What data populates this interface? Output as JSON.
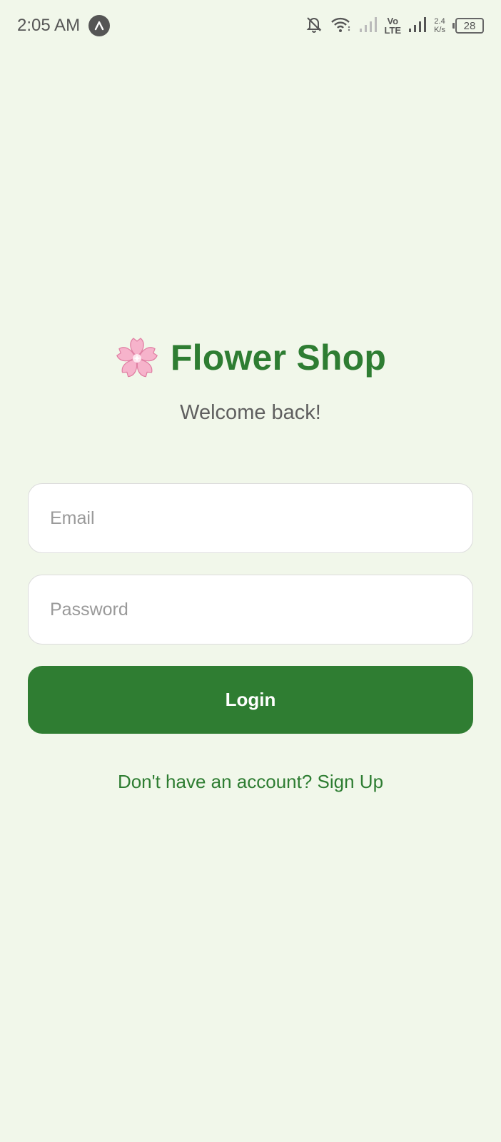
{
  "status_bar": {
    "time": "2:05 AM",
    "network_speed_value": "2.4",
    "network_speed_unit": "K/s",
    "signal_label_top": "Vo",
    "signal_label_bottom": "LTE",
    "battery_level": "28",
    "icons": [
      "app-notification-icon",
      "bell-off-icon",
      "wifi-icon",
      "signal-icon",
      "volte-icon",
      "signal-icon",
      "battery-icon"
    ]
  },
  "header": {
    "title": "Flower Shop",
    "subtitle": "Welcome back!",
    "logo_icon": "cherry-blossom-icon"
  },
  "form": {
    "email_placeholder": "Email",
    "email_value": "",
    "password_placeholder": "Password",
    "password_value": "",
    "login_label": "Login",
    "signup_text": "Don't have an account? Sign Up"
  },
  "colors": {
    "background": "#f1f7ea",
    "brand_green": "#2e7d32",
    "button_green": "#2f7d32",
    "blossom_pink": "#f4a7c3"
  }
}
